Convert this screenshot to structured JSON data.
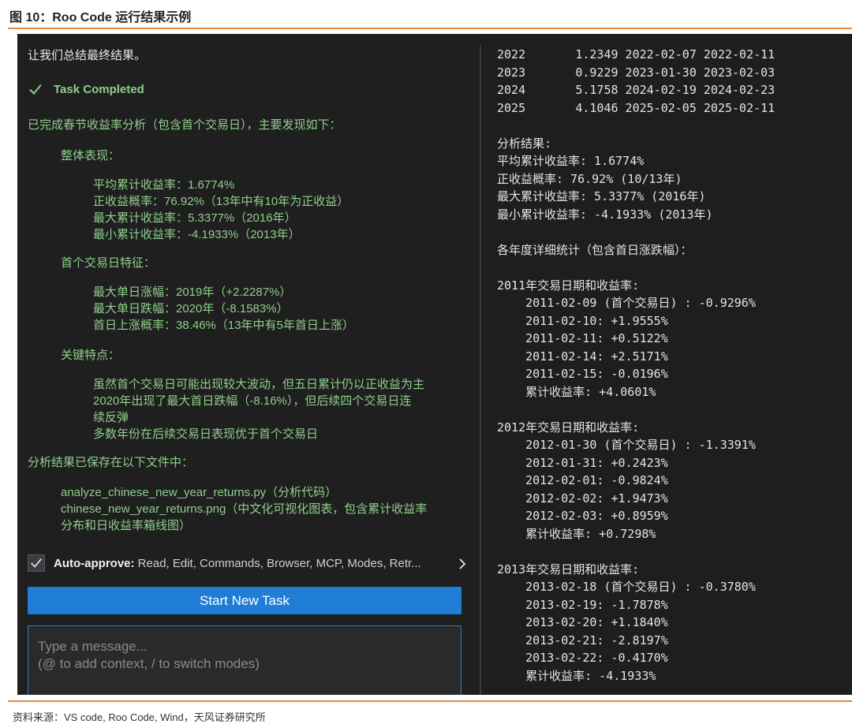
{
  "caption": {
    "title": "图 10：Roo Code 运行结果示例",
    "source": "资料来源：VS code, Roo Code, Wind，天风证券研究所"
  },
  "chat": {
    "intro": "让我们总结最终结果。",
    "task_completed": "Task Completed",
    "summary_heading": "已完成春节收益率分析（包含首个交易日），主要发现如下：",
    "overall": {
      "heading": "整体表现：",
      "items": [
        "平均累计收益率：1.6774%",
        "正收益概率：76.92%（13年中有10年为正收益）",
        "最大累计收益率：5.3377%（2016年）",
        "最小累计收益率：-4.1933%（2013年）"
      ]
    },
    "first_day": {
      "heading": "首个交易日特征：",
      "items": [
        "最大单日涨幅：2019年（+2.2287%）",
        "最大单日跌幅：2020年（-8.1583%）",
        "首日上涨概率：38.46%（13年中有5年首日上涨）"
      ]
    },
    "key": {
      "heading": "关键特点：",
      "items": [
        "虽然首个交易日可能出现较大波动，但五日累计仍以正收益为主",
        "2020年出现了最大首日跌幅（-8.16%），但后续四个交易日连",
        "续反弹",
        "多数年份在后续交易日表现优于首个交易日"
      ]
    },
    "saved": {
      "heading": "分析结果已保存在以下文件中：",
      "items": [
        "analyze_chinese_new_year_returns.py（分析代码）",
        "chinese_new_year_returns.png（中文化可视化图表，包含累计收益率",
        "分布和日收益率箱线图）"
      ]
    },
    "auto_approve": {
      "label": "Auto-approve:",
      "value": "Read, Edit, Commands, Browser, MCP, Modes, Retr..."
    },
    "start_button": "Start New Task",
    "input": {
      "placeholder_line1": "Type a message...",
      "placeholder_line2": "(@ to add context, / to switch modes)"
    }
  },
  "terminal": {
    "lines": [
      "2022       1.2349 2022-02-07 2022-02-11",
      "2023       0.9229 2023-01-30 2023-02-03",
      "2024       5.1758 2024-02-19 2024-02-23",
      "2025       4.1046 2025-02-05 2025-02-11",
      "",
      "分析结果:",
      "平均累计收益率: 1.6774%",
      "正收益概率: 76.92% (10/13年)",
      "最大累计收益率: 5.3377% (2016年)",
      "最小累计收益率: -4.1933% (2013年)",
      "",
      "各年度详细统计（包含首日涨跌幅）：",
      "",
      "2011年交易日期和收益率:",
      "    2011-02-09 (首个交易日) : -0.9296%",
      "    2011-02-10: +1.9555%",
      "    2011-02-11: +0.5122%",
      "    2011-02-14: +2.5171%",
      "    2011-02-15: -0.0196%",
      "    累计收益率: +4.0601%",
      "",
      "2012年交易日期和收益率:",
      "    2012-01-30 (首个交易日) : -1.3391%",
      "    2012-01-31: +0.2423%",
      "    2012-02-01: -0.9824%",
      "    2012-02-02: +1.9473%",
      "    2012-02-03: +0.8959%",
      "    累计收益率: +0.7298%",
      "",
      "2013年交易日期和收益率:",
      "    2013-02-18 (首个交易日) : -0.3780%",
      "    2013-02-19: -1.7878%",
      "    2013-02-20: +1.1840%",
      "    2013-02-21: -2.8197%",
      "    2013-02-22: -0.4170%",
      "    累计收益率: -4.1933%"
    ]
  }
}
